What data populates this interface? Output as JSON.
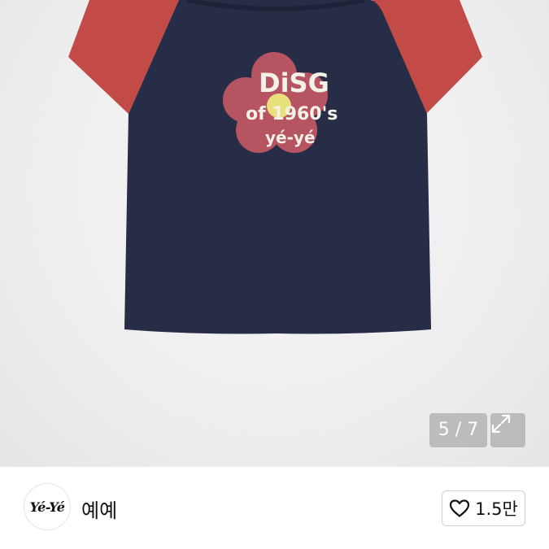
{
  "gallery": {
    "counter": "5 / 7",
    "expand_icon": "expand-icon",
    "print_lines": [
      "DiSG",
      "of 1960's",
      "yé-yé"
    ]
  },
  "seller": {
    "avatar_text": "Yé-Yé",
    "name": "예예",
    "like_icon": "heart-icon",
    "like_count": "1.5만"
  },
  "colors": {
    "shirt_body": "#282d47",
    "shirt_sleeve": "#c24a47",
    "flower": "#b75461",
    "flower_center": "#e8e07a"
  }
}
